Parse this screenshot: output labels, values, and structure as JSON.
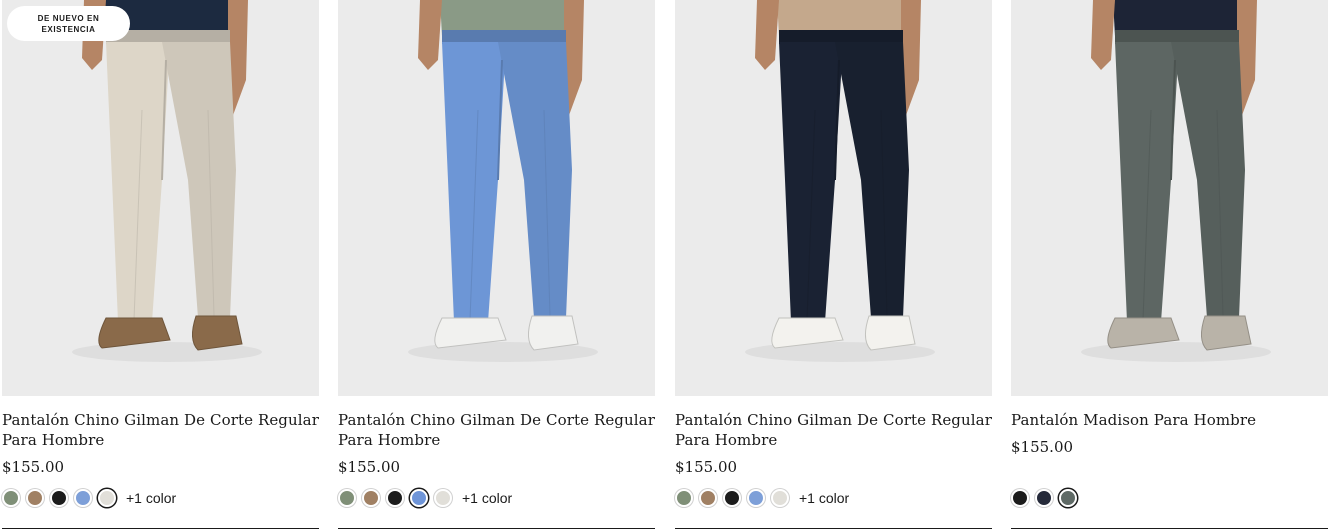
{
  "products": [
    {
      "badge": "DE NUEVO EN EXISTENCIA",
      "name": "Pantalón Chino Gilman De Corte Regular Para Hombre",
      "price": "$155.00",
      "more_colors": "+1 color",
      "swatches": [
        "#7f8f77",
        "#a08063",
        "#1c1c1c",
        "#7d9fd8",
        "#e1dfd9"
      ],
      "selected_swatch": 4,
      "pants_color": "#ddd6c8",
      "shirt_color": "#1c2a40",
      "shoe_color": "#8a6a4a"
    },
    {
      "name": "Pantalón Chino Gilman De Corte Regular Para Hombre",
      "price": "$155.00",
      "more_colors": "+1 color",
      "swatches": [
        "#7f8f77",
        "#a08063",
        "#1c1c1c",
        "#6f95d8",
        "#e1dfd9"
      ],
      "selected_swatch": 3,
      "pants_color": "#6d96d6",
      "shirt_color": "#8a9a86",
      "shoe_color": "#f1f1ef"
    },
    {
      "name": "Pantalón Chino Gilman De Corte Regular Para Hombre",
      "price": "$155.00",
      "more_colors": "+1 color",
      "swatches": [
        "#7f8f77",
        "#a08063",
        "#1c1c1c",
        "#7d9fd8",
        "#e1dfd9"
      ],
      "selected_swatch": -1,
      "pants_color": "#1a2233",
      "shirt_color": "#c4a88c",
      "shoe_color": "#f3f2ee"
    },
    {
      "name": "Pantalón Madison Para Hombre",
      "price": "$155.00",
      "more_colors": "",
      "swatches": [
        "#1c1c1c",
        "#252a3a",
        "#5f6a66"
      ],
      "selected_swatch": 2,
      "pants_color": "#5d6663",
      "shirt_color": "#1d2436",
      "shoe_color": "#b9b3a8"
    }
  ]
}
